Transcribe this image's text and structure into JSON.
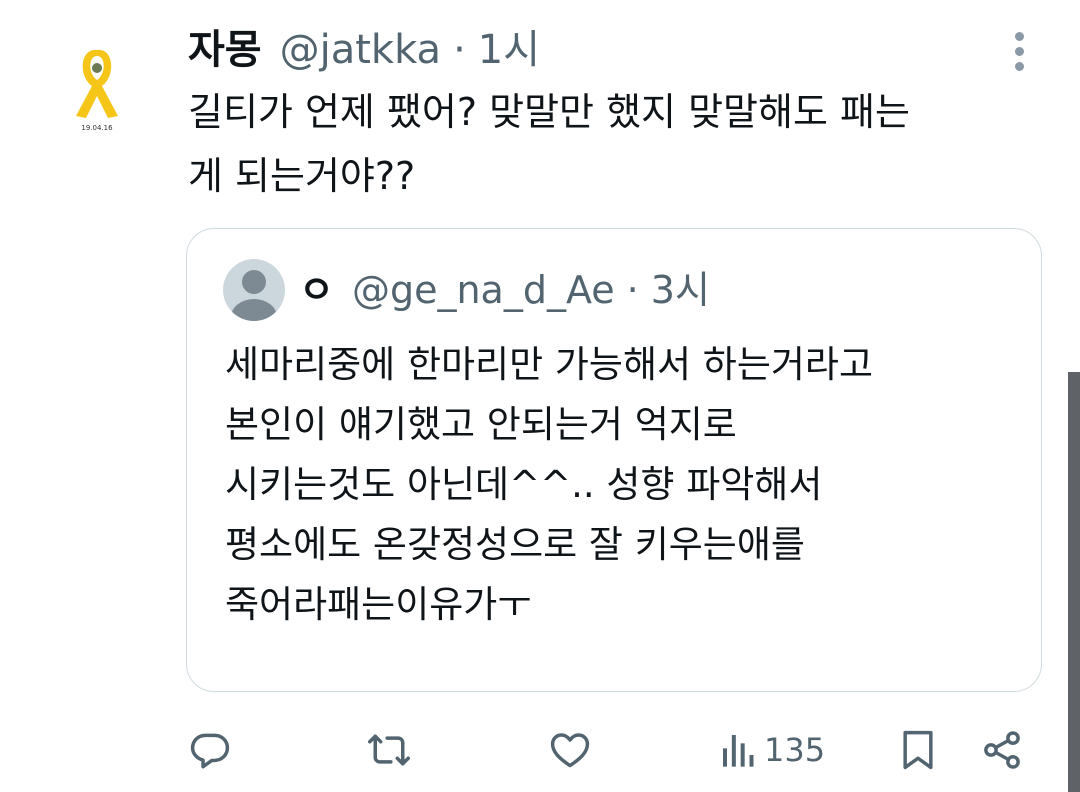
{
  "tweet": {
    "display_name": "자몽",
    "handle": "@jatkka",
    "separator": "·",
    "time": "1시",
    "text_lines": [
      "길티가 언제 팼어? 맞말만 했지 맞말해도 패는",
      "게 되는거야??"
    ],
    "avatar_caption": "19.04.16"
  },
  "quote": {
    "display_name": "ㅇ",
    "handle": "@ge_na_d_Ae",
    "separator": "·",
    "time": "3시",
    "text_lines": [
      "세마리중에 한마리만 가능해서 하는거라고",
      "본인이 얘기했고 안되는거 억지로",
      "시키는것도 아닌데^^.. 성향 파악해서",
      "평소에도 온갖정성으로 잘 키우는애를",
      "죽어라패는이유가ㅜ"
    ]
  },
  "actions": {
    "views": "135"
  },
  "icons": {
    "reply": "reply-icon",
    "retweet": "retweet-icon",
    "like": "like-icon",
    "views": "views-icon",
    "bookmark": "bookmark-icon",
    "share": "share-icon",
    "more": "more-vertical-icon"
  },
  "colors": {
    "text": "#0f1419",
    "secondary": "#536471",
    "border": "#cfd9de",
    "ribbon": "#f5c518"
  }
}
